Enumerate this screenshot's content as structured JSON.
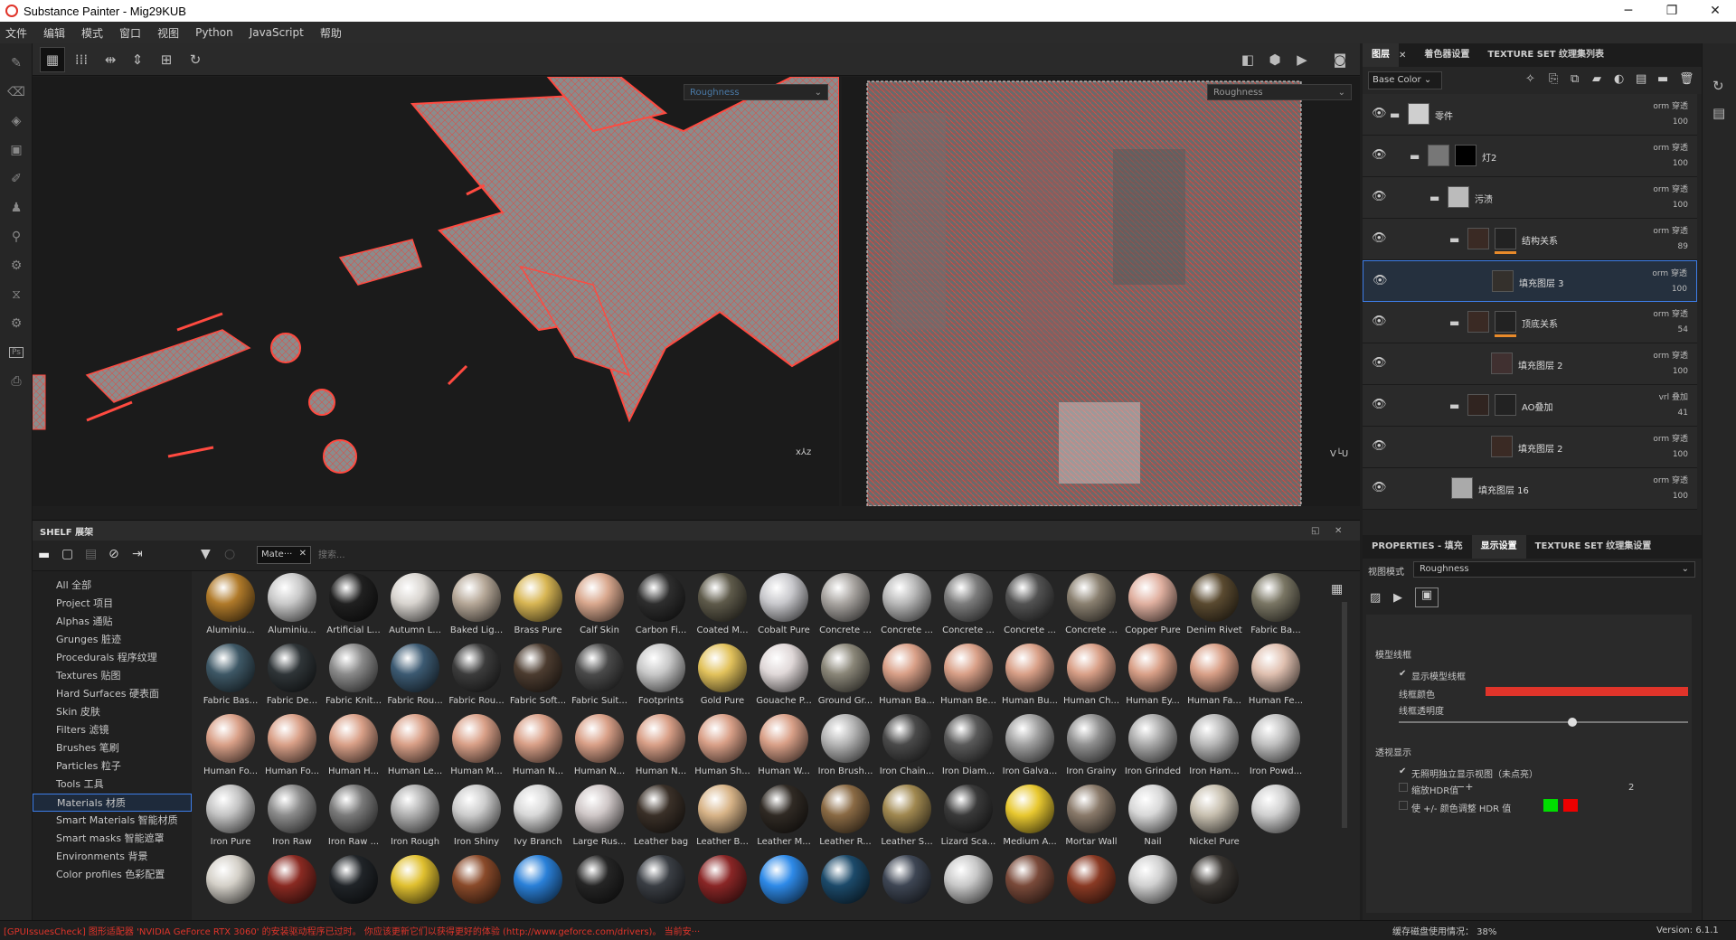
{
  "window": {
    "title": "Substance Painter - Mig29KUB",
    "min": "─",
    "max": "❐",
    "close": "✕"
  },
  "menu": [
    "文件",
    "编辑",
    "模式",
    "窗口",
    "视图",
    "Python",
    "JavaScript",
    "帮助"
  ],
  "viewport": {
    "left_channel": "Roughness",
    "right_channel": "Roughness"
  },
  "shelf": {
    "title": "SHELF 展架",
    "filter_tag": "Mate···",
    "search_placeholder": "搜索...",
    "categories": [
      "All 全部",
      "Project 项目",
      "Alphas 通贴",
      "Grunges 脏迹",
      "Procedurals 程序纹理",
      "Textures 贴图",
      "Hard Surfaces 硬表面",
      "Skin 皮肤",
      "Filters 滤镜",
      "Brushes 笔刷",
      "Particles 粒子",
      "Tools 工具",
      "Materials 材质",
      "Smart Materials 智能材质",
      "Smart masks 智能遮罩",
      "Environments 背景",
      "Color profiles 色彩配置"
    ],
    "selected_category": "Materials 材质",
    "materials": [
      {
        "name": "Aluminiu...",
        "color": "#b07a2a"
      },
      {
        "name": "Aluminiu...",
        "color": "#c9c9c9"
      },
      {
        "name": "Artificial L...",
        "color": "#202020"
      },
      {
        "name": "Autumn L...",
        "color": "#d8d4cf"
      },
      {
        "name": "Baked Lig...",
        "color": "#b6a898"
      },
      {
        "name": "Brass Pure",
        "color": "#d8b654"
      },
      {
        "name": "Calf Skin",
        "color": "#d9a88e"
      },
      {
        "name": "Carbon Fi...",
        "color": "#2e2e2e"
      },
      {
        "name": "Coated M...",
        "color": "#5e5a4a"
      },
      {
        "name": "Cobalt Pure",
        "color": "#c8c8cc"
      },
      {
        "name": "Concrete ...",
        "color": "#a8a4a0"
      },
      {
        "name": "Concrete ...",
        "color": "#b8b8b8"
      },
      {
        "name": "Concrete ...",
        "color": "#7c7c7c"
      },
      {
        "name": "Concrete ...",
        "color": "#535353"
      },
      {
        "name": "Concrete ...",
        "color": "#8a8070"
      },
      {
        "name": "Copper Pure",
        "color": "#e0b0a0"
      },
      {
        "name": "Denim Rivet",
        "color": "#5a4a30"
      },
      {
        "name": "Fabric Ba...",
        "color": "#7a7664"
      },
      {
        "name": "Fabric Bas...",
        "color": "#3e5866"
      },
      {
        "name": "Fabric De...",
        "color": "#2f3538"
      },
      {
        "name": "Fabric Knit...",
        "color": "#8a8a8a"
      },
      {
        "name": "Fabric Rou...",
        "color": "#3c5a72"
      },
      {
        "name": "Fabric Rou...",
        "color": "#3c3c3c"
      },
      {
        "name": "Fabric Soft...",
        "color": "#4c3c30"
      },
      {
        "name": "Fabric Suit...",
        "color": "#4a4a4a"
      },
      {
        "name": "Footprints",
        "color": "#c8c8c8"
      },
      {
        "name": "Gold Pure",
        "color": "#e2c25c"
      },
      {
        "name": "Gouache P...",
        "color": "#e0d8d8"
      },
      {
        "name": "Ground Gr...",
        "color": "#8a8678"
      },
      {
        "name": "Human Ba...",
        "color": "#d9a088"
      },
      {
        "name": "Human Be...",
        "color": "#d9a088"
      },
      {
        "name": "Human Bu...",
        "color": "#d9a088"
      },
      {
        "name": "Human Ch...",
        "color": "#d9a088"
      },
      {
        "name": "Human Ey...",
        "color": "#d9a088"
      },
      {
        "name": "Human Fa...",
        "color": "#d9a088"
      },
      {
        "name": "Human Fe...",
        "color": "#e0c0b0"
      },
      {
        "name": "Human Fo...",
        "color": "#d9a088"
      },
      {
        "name": "Human Fo...",
        "color": "#d9a088"
      },
      {
        "name": "Human H...",
        "color": "#d9a088"
      },
      {
        "name": "Human Le...",
        "color": "#d9a088"
      },
      {
        "name": "Human M...",
        "color": "#d9a088"
      },
      {
        "name": "Human N...",
        "color": "#d9a088"
      },
      {
        "name": "Human N...",
        "color": "#d9a088"
      },
      {
        "name": "Human N...",
        "color": "#d9a088"
      },
      {
        "name": "Human Sh...",
        "color": "#d9a088"
      },
      {
        "name": "Human W...",
        "color": "#d9a088"
      },
      {
        "name": "Iron Brush...",
        "color": "#b4b4b4"
      },
      {
        "name": "Iron Chain...",
        "color": "#4a4a4a"
      },
      {
        "name": "Iron Diam...",
        "color": "#5a5a5a"
      },
      {
        "name": "Iron Galva...",
        "color": "#a0a0a0"
      },
      {
        "name": "Iron Grainy",
        "color": "#909090"
      },
      {
        "name": "Iron Grinded",
        "color": "#aaaaaa"
      },
      {
        "name": "Iron Ham...",
        "color": "#b8b8b8"
      },
      {
        "name": "Iron Powd...",
        "color": "#c0c0c0"
      },
      {
        "name": "Iron Pure",
        "color": "#c4c4c4"
      },
      {
        "name": "Iron Raw",
        "color": "#8c8c8c"
      },
      {
        "name": "Iron Raw ...",
        "color": "#7a7a7a"
      },
      {
        "name": "Iron Rough",
        "color": "#b0b0b0"
      },
      {
        "name": "Iron Shiny",
        "color": "#cccccc"
      },
      {
        "name": "Ivy Branch",
        "color": "#d8d8d8"
      },
      {
        "name": "Large Rus...",
        "color": "#d0c8c8"
      },
      {
        "name": "Leather bag",
        "color": "#3a3028"
      },
      {
        "name": "Leather B...",
        "color": "#d8b488"
      },
      {
        "name": "Leather M...",
        "color": "#302a24"
      },
      {
        "name": "Leather R...",
        "color": "#8a6a44"
      },
      {
        "name": "Leather S...",
        "color": "#a08850"
      },
      {
        "name": "Lizard Sca...",
        "color": "#3a3a3a"
      },
      {
        "name": "Medium A...",
        "color": "#e8c830"
      },
      {
        "name": "Mortar Wall",
        "color": "#8a7a6a"
      },
      {
        "name": "Nail",
        "color": "#d8d8d8"
      },
      {
        "name": "Nickel Pure",
        "color": "#c8c0b0"
      },
      {
        "name": "",
        "color": "#d0d0d0"
      },
      {
        "name": "",
        "color": "#d4d0c8"
      },
      {
        "name": "",
        "color": "#8a2a22"
      },
      {
        "name": "",
        "color": "#202428"
      },
      {
        "name": "",
        "color": "#e0c030"
      },
      {
        "name": "",
        "color": "#8a4a2a"
      },
      {
        "name": "",
        "color": "#2a80d8"
      },
      {
        "name": "",
        "color": "#252525"
      },
      {
        "name": "",
        "color": "#3a3e44"
      },
      {
        "name": "",
        "color": "#8a2626"
      },
      {
        "name": "",
        "color": "#2e8ae8"
      },
      {
        "name": "",
        "color": "#1c4a6a"
      },
      {
        "name": "",
        "color": "#3e4654"
      },
      {
        "name": "",
        "color": "#c8c8c8"
      },
      {
        "name": "",
        "color": "#7a4a3a"
      },
      {
        "name": "",
        "color": "#8a3a24"
      },
      {
        "name": "",
        "color": "#d0d0d0"
      },
      {
        "name": "",
        "color": "#3a3632"
      }
    ]
  },
  "layers_panel": {
    "tabs": [
      "图层",
      "着色器设置",
      "TEXTURE SET 纹理集列表"
    ],
    "channel": "Base Color",
    "layers": [
      {
        "name": "零件",
        "blend": "orm 穿透",
        "opacity": "100"
      },
      {
        "name": "灯2",
        "blend": "orm 穿透",
        "opacity": "100"
      },
      {
        "name": "污渍",
        "blend": "orm 穿透",
        "opacity": "100"
      },
      {
        "name": "结构关系",
        "blend": "orm 穿透",
        "opacity": "89"
      },
      {
        "name": "填充图层 3",
        "blend": "orm 穿透",
        "opacity": "100"
      },
      {
        "name": "顶底关系",
        "blend": "orm 穿透",
        "opacity": "54"
      },
      {
        "name": "填充图层 2",
        "blend": "orm 穿透",
        "opacity": "100"
      },
      {
        "name": "AO叠加",
        "blend": "vrl 叠加",
        "opacity": "41"
      },
      {
        "name": "填充图层 2",
        "blend": "orm 穿透",
        "opacity": "100"
      },
      {
        "name": "填充图层 16",
        "blend": "orm 穿透",
        "opacity": "100"
      }
    ]
  },
  "properties": {
    "tabs": [
      "PROPERTIES - 填充",
      "显示设置",
      "TEXTURE SET 纹理集设置"
    ],
    "view_mode_label": "视图模式",
    "view_mode": "Roughness",
    "wireframe_section": "模型线框",
    "show_wireframe": "显示模型线框",
    "wire_color_label": "线框颜色",
    "wire_color": "#e0342a",
    "wire_opacity_label": "线框透明度",
    "wire_opacity": 0.6,
    "transparency_section": "透视显示",
    "isolate": "无照明独立显示视图（未点亮）",
    "hdr_label": "缩放HDR值",
    "hdr_value": "2",
    "hdr_color_label": "使 +/- 颜色调整 HDR 值",
    "hdr_green": "#00dd00",
    "hdr_red": "#ee0000"
  },
  "status": {
    "message": "[GPUIssuesCheck] 图形适配器 'NVIDIA GeForce RTX 3060' 的安装驱动程序已过时。 你应该更新它们以获得更好的体验 (http://www.geforce.com/drivers)。 当前安···",
    "cache": "缓存磁盘使用情况： 38%",
    "version": "Version: 6.1.1"
  }
}
